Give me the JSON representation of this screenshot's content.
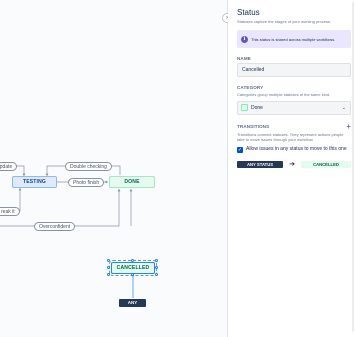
{
  "canvas": {
    "nodes": {
      "testing": "TESTING",
      "done": "DONE",
      "cancelled": "CANCELLED",
      "any_status": "ANY STATUS"
    },
    "transitions": {
      "update": "update",
      "double_checking": "Double checking",
      "photo_finish": "Photo finish",
      "break_it": "reak it",
      "overconfident": "Overconfident"
    }
  },
  "panel": {
    "collapse_icon": "chevron-right-icon",
    "title": "Status",
    "subtitle": "Statuses capture the stages of your working process.",
    "info": {
      "icon": "info-icon",
      "text": "This status is shared across multiple workflows."
    },
    "name": {
      "label": "NAME",
      "value": "Cancelled"
    },
    "category": {
      "label": "CATEGORY",
      "description": "Categories group multiple statuses of the same kind.",
      "value": "Done",
      "color": "#e3fcef"
    },
    "transitions": {
      "label": "TRANSITIONS",
      "description": "Transitions connect statuses. They represent actions people take to move issues through your workflow.",
      "allow_any_label": "Allow issues in any status to move to this one",
      "allow_any_checked": true,
      "rows": [
        {
          "from": "ANY STATUS",
          "to": "CANCELLED"
        }
      ]
    }
  },
  "colors": {
    "in_progress_bg": "#deebff",
    "done_bg": "#e3fcef",
    "any_status_bg": "#253858",
    "accent": "#0052cc",
    "info_bg": "#eae6ff"
  }
}
